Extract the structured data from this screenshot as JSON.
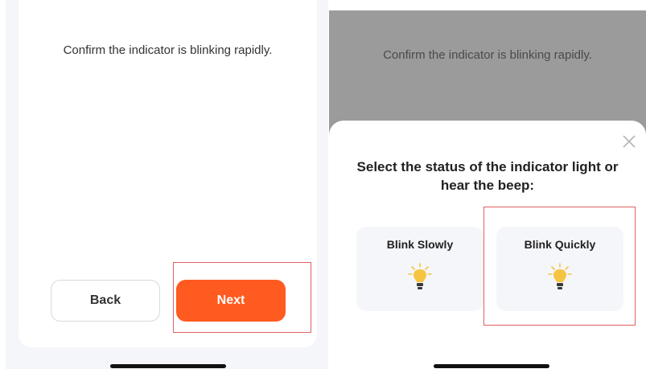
{
  "left_screen": {
    "instruction": "Confirm the indicator is blinking rapidly.",
    "back_label": "Back",
    "next_label": "Next"
  },
  "right_screen": {
    "instruction": "Confirm the indicator is blinking rapidly.",
    "sheet_title": "Select the status of the indicator light or hear the beep:",
    "options": [
      {
        "label": "Blink Slowly",
        "icon": "lightbulb-icon"
      },
      {
        "label": "Blink Quickly",
        "icon": "lightbulb-icon"
      }
    ]
  },
  "colors": {
    "accent": "#ff5a1f",
    "highlight_box": "#e06060",
    "overlay": "#9b9b9b",
    "bulb": "#f5c542"
  }
}
